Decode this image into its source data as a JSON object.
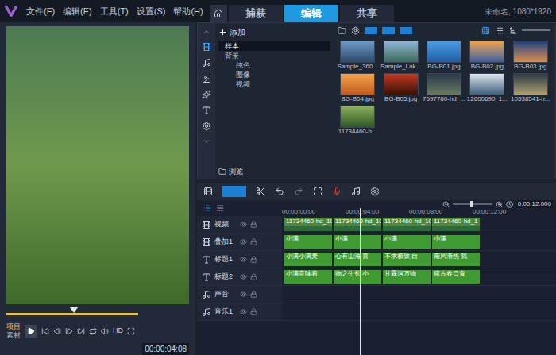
{
  "menu": [
    "文件(F)",
    "编辑(E)",
    "工具(T)",
    "设置(S)",
    "帮助(H)"
  ],
  "tabs": [
    {
      "label": "捕获",
      "selected": false
    },
    {
      "label": "编辑",
      "selected": true
    },
    {
      "label": "共享",
      "selected": false
    }
  ],
  "project_info": "未命名, 1080*1920",
  "player": {
    "scrub_level": 0.37,
    "modes": [
      {
        "label": "项目",
        "selected": true
      },
      {
        "label": "素材",
        "selected": false
      }
    ],
    "hd": "HD",
    "timecode": "00:00:04:08"
  },
  "library": {
    "add": "添加",
    "browse": "浏览",
    "tree": [
      {
        "label": "样本",
        "selected": true,
        "depth": 0
      },
      {
        "label": "背景",
        "selected": false,
        "depth": 0
      },
      {
        "label": "纯色",
        "selected": false,
        "depth": 1
      },
      {
        "label": "图像",
        "selected": false,
        "depth": 1
      },
      {
        "label": "视频",
        "selected": false,
        "depth": 1
      }
    ],
    "thumbnails": [
      "Sample_360...",
      "Sample_Lak...",
      "BG-B01.jpg",
      "BG-B02.jpg",
      "BG-B03.jpg",
      "BG-B04.jpg",
      "BG-B05.jpg",
      "7597760-hd_...",
      "12600690_1...",
      "10538541-h...",
      "11734460-h..."
    ]
  },
  "timeline": {
    "ruler": [
      "00:00:00:00",
      "00:00:04:00",
      "00:00:08:00",
      "00:00:12:00"
    ],
    "total": "0:00:12:000",
    "zoom_level": 0.45,
    "playhead": 0.28,
    "tracks": [
      {
        "name": "视频",
        "kind": "video",
        "clips": [
          "11734460-hd_10",
          "11734460-hd_10",
          "11734460-hd_10",
          "11734460-hd_1"
        ]
      },
      {
        "name": "叠加1",
        "kind": "overlay",
        "clips": [
          "小满",
          "小满",
          "小满",
          "小满"
        ]
      },
      {
        "name": "标题1",
        "kind": "title",
        "clips": [
          "小满小满麦",
          "心有山海 喜",
          "不求极致 自",
          "南风渐热 我"
        ]
      },
      {
        "name": "标题2",
        "kind": "title",
        "clips": [
          "小满意味着",
          "物之生长 小",
          "甘霖润万物",
          "猪古春日青"
        ]
      },
      {
        "name": "声音",
        "kind": "audio",
        "clips": []
      },
      {
        "name": "音乐1",
        "kind": "audio",
        "clips": []
      }
    ]
  }
}
